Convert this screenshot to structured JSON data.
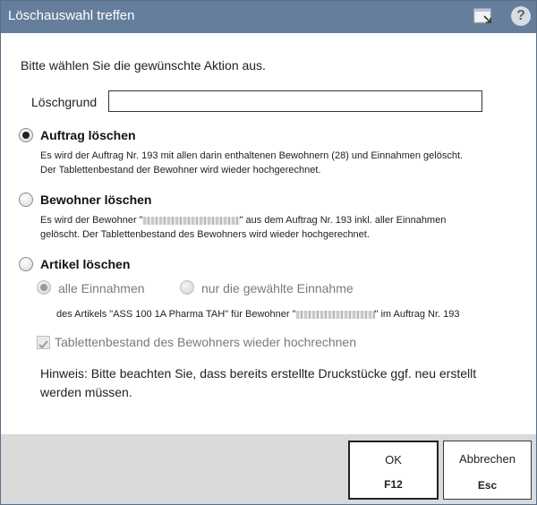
{
  "window": {
    "title": "Löschauswahl treffen"
  },
  "titlebar_icons": {
    "window": "window-restore-icon",
    "help": "help-icon",
    "help_glyph": "?"
  },
  "prompt": "Bitte wählen Sie die gewünschte Aktion aus.",
  "loeschgrund": {
    "label": "Löschgrund",
    "value": ""
  },
  "options": [
    {
      "title": "Auftrag löschen",
      "selected": true,
      "desc_line1": "Es wird der Auftrag Nr. 193 mit allen darin enthaltenen Bewohnern (28) und Einnahmen gelöscht.",
      "desc_line2": "Der Tablettenbestand der Bewohner wird wieder hochgerechnet."
    },
    {
      "title": "Bewohner löschen",
      "selected": false,
      "desc_pre": "Es wird der Bewohner \"",
      "desc_post": "\" aus dem Auftrag Nr. 193 inkl. aller Einnahmen",
      "desc_line2": "gelöscht. Der Tablettenbestand des Bewohners wird wieder hochgerechnet."
    },
    {
      "title": "Artikel löschen",
      "selected": false,
      "sub_all": "alle Einnahmen",
      "sub_selected": "nur die gewählte Einnahme",
      "article_pre": "des Artikels \"ASS 100 1A Pharma TAH\" für Bewohner \"",
      "article_post": "\" im Auftrag Nr. 193",
      "recalc_label": "Tablettenbestand des Bewohners wieder hochrechnen",
      "recalc_checked": true
    }
  ],
  "hint": {
    "prefix": "Hinweis:",
    "text": "Bitte beachten Sie, dass bereits erstellte Druckstücke ggf. neu erstellt werden müssen."
  },
  "buttons": {
    "ok": {
      "label": "OK",
      "key": "F12"
    },
    "cancel": {
      "label": "Abbrechen",
      "key": "Esc"
    }
  }
}
